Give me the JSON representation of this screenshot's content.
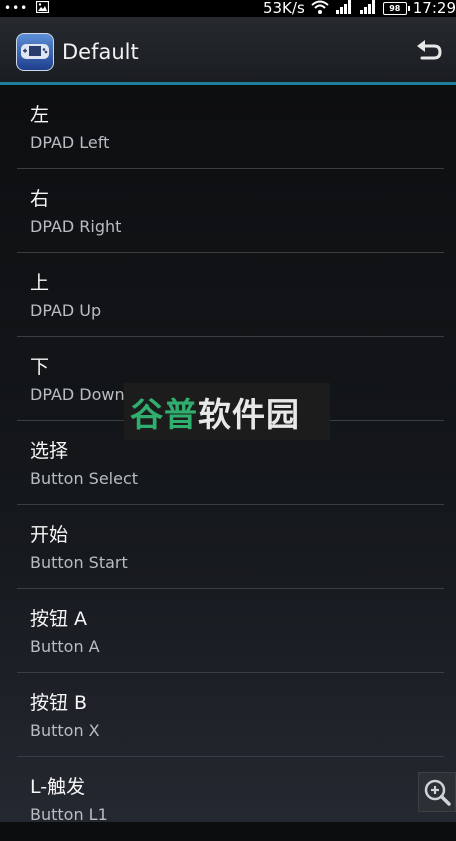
{
  "status_bar": {
    "left_dots": "•••",
    "speed": "53K/s",
    "battery": "98",
    "time": "17:29"
  },
  "action_bar": {
    "title": "Default",
    "app_icon": "gba-controller-icon",
    "back_icon": "undo-arrow-icon"
  },
  "items": [
    {
      "title": "左",
      "subtitle": "DPAD Left"
    },
    {
      "title": "右",
      "subtitle": "DPAD Right"
    },
    {
      "title": "上",
      "subtitle": "DPAD Up"
    },
    {
      "title": "下",
      "subtitle": "DPAD Down"
    },
    {
      "title": "选择",
      "subtitle": "Button Select"
    },
    {
      "title": "开始",
      "subtitle": "Button Start"
    },
    {
      "title": "按钮 A",
      "subtitle": "Button A"
    },
    {
      "title": "按钮 B",
      "subtitle": "Button X"
    },
    {
      "title": "L-触发",
      "subtitle": "Button L1"
    }
  ],
  "watermark": {
    "text_green": "谷普",
    "text_white": "软件园"
  },
  "zoom_icon": "zoom-in-icon"
}
